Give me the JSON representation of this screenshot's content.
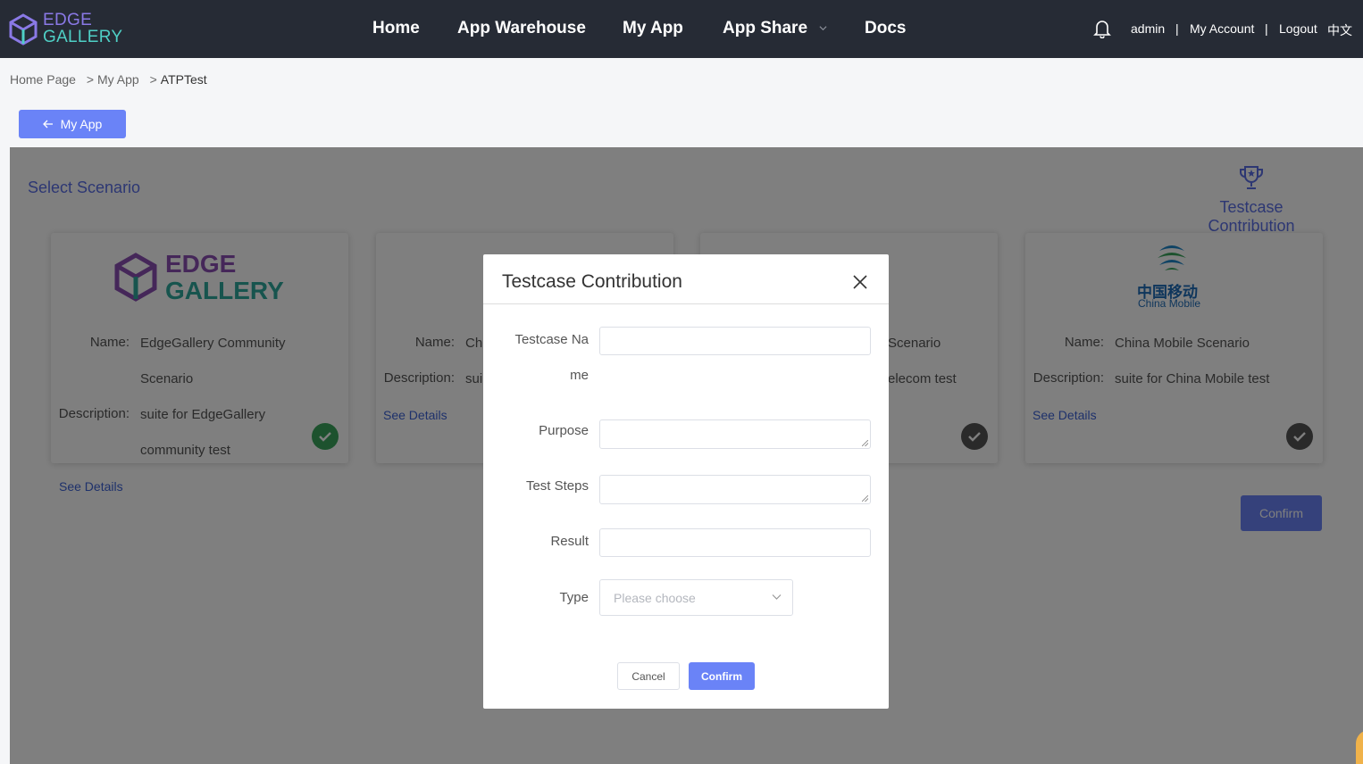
{
  "header": {
    "logo_line1": "EDGE",
    "logo_line2": "GALLERY",
    "nav": [
      "Home",
      "App Warehouse",
      "My App",
      "App Share",
      "Docs"
    ],
    "user": "admin",
    "sep": "|",
    "my_account": "My Account",
    "logout": "Logout",
    "lang": "中文"
  },
  "breadcrumb": {
    "items": [
      "Home Page",
      "My App",
      "ATPTest"
    ],
    "separator": ">"
  },
  "back_button": {
    "label": "My App",
    "icon": "arrow-left-icon"
  },
  "main": {
    "section_title": "Select Scenario",
    "contribution_link": "Testcase Contribution",
    "confirm_label": "Confirm"
  },
  "scenarios": [
    {
      "logo_text_1": "EDGE",
      "logo_text_2": "GALLERY",
      "name_label": "Name:",
      "name_line1": "EdgeGallery Community",
      "name_line2": "Scenario",
      "desc_label": "Description:",
      "desc_line1": "suite for EdgeGallery",
      "desc_line2": "community test",
      "see_details": "See Details",
      "selected": true
    },
    {
      "name_label": "Name:",
      "name_line1": "Ch",
      "desc_label": "Description:",
      "desc_line1": "sui",
      "see_details": "See Details",
      "selected": false
    },
    {
      "name_line1": "Scenario",
      "desc_line1": "elecom test",
      "selected": false
    },
    {
      "logo_cn": "中国移动",
      "logo_en": "China Mobile",
      "name_label": "Name:",
      "name_line1": "China Mobile Scenario",
      "desc_label": "Description:",
      "desc_line1": "suite for China Mobile test",
      "see_details": "See Details",
      "selected": false
    }
  ],
  "dialog": {
    "title": "Testcase Contribution",
    "fields": {
      "name_label_1": "Testcase Na",
      "name_label_2": "me",
      "purpose_label": "Purpose",
      "steps_label": "Test Steps",
      "result_label": "Result",
      "type_label": "Type",
      "type_placeholder": "Please choose"
    },
    "cancel_label": "Cancel",
    "confirm_label": "Confirm"
  },
  "colors": {
    "topbar": "#262b35",
    "accent": "#6a83f7",
    "link": "#3d62d6",
    "selected_check": "#3aa55c",
    "logo_purple": "#8a79e6",
    "logo_teal": "#4fd0c6"
  }
}
